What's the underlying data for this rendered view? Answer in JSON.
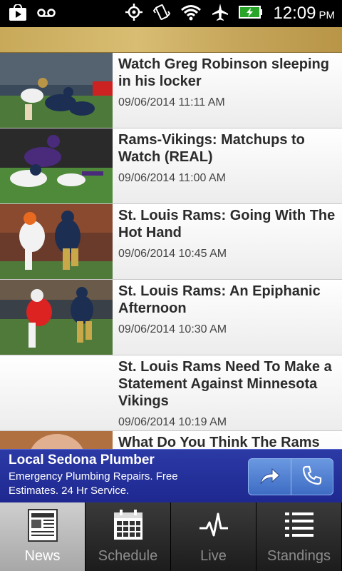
{
  "status_bar": {
    "time": "12:09",
    "ampm": "PM",
    "icons": [
      "play-store-icon",
      "voicemail-icon",
      "gps-icon",
      "vibrate-icon",
      "wifi-icon",
      "airplane-icon",
      "battery-charging-icon"
    ]
  },
  "news": {
    "items": [
      {
        "title": "Watch Greg Robinson sleeping in his locker",
        "date": "09/06/2014 11:11 AM",
        "has_thumb": true
      },
      {
        "title": "Rams-Vikings: Matchups to Watch (REAL)",
        "date": "09/06/2014 11:00 AM",
        "has_thumb": true
      },
      {
        "title": "St. Louis Rams: Going With The Hot Hand",
        "date": "09/06/2014 10:45 AM",
        "has_thumb": true
      },
      {
        "title": "St. Louis Rams: An Epiphanic Afternoon",
        "date": "09/06/2014 10:30 AM",
        "has_thumb": true
      },
      {
        "title": "St. Louis Rams Need To Make a Statement Against Minnesota Vikings",
        "date": "09/06/2014 10:19 AM",
        "has_thumb": false
      },
      {
        "title": "What Do You Think The Rams",
        "date": "",
        "has_thumb": true
      }
    ]
  },
  "ad": {
    "title": "Local Sedona Plumber",
    "description": "Emergency Plumbing Repairs. Free Estimates. 24 Hr Service.",
    "buttons": [
      "share-arrow-icon",
      "phone-icon"
    ]
  },
  "tabs": [
    {
      "label": "News",
      "icon": "newspaper-icon",
      "active": true
    },
    {
      "label": "Schedule",
      "icon": "calendar-icon",
      "active": false
    },
    {
      "label": "Live",
      "icon": "pulse-icon",
      "active": false
    },
    {
      "label": "Standings",
      "icon": "list-icon",
      "active": false
    }
  ]
}
